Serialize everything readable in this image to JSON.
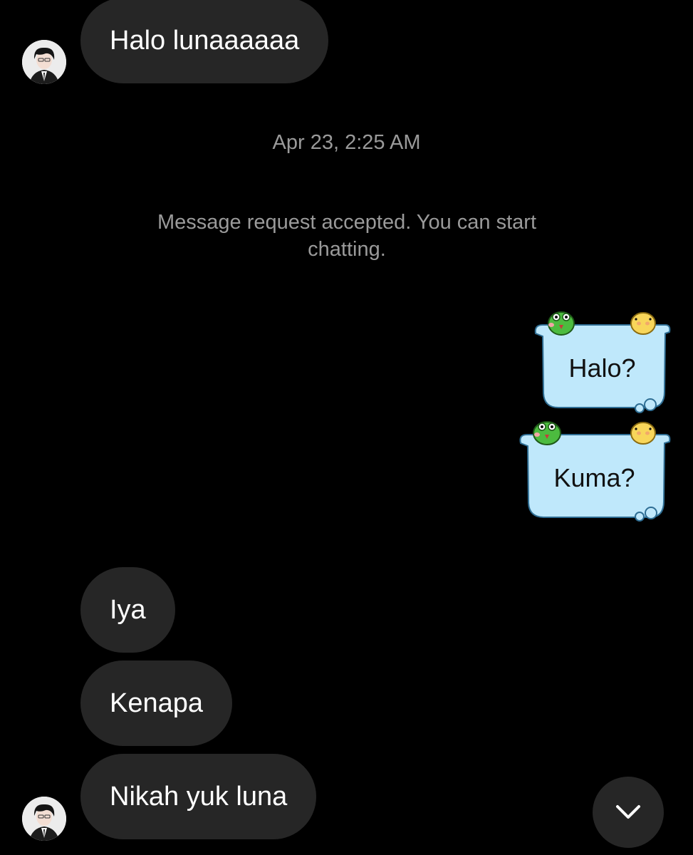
{
  "thread": {
    "timestamp": "Apr 23, 2:25 AM",
    "system_note": "Message request accepted. You can start chatting."
  },
  "messages": [
    {
      "direction": "incoming",
      "text": "Halo lunaaaaaa"
    },
    {
      "direction": "outgoing",
      "style": "sticker-bubble",
      "text": "Halo?"
    },
    {
      "direction": "outgoing",
      "style": "sticker-bubble",
      "text": "Kuma?"
    },
    {
      "direction": "incoming",
      "text": "Iya"
    },
    {
      "direction": "incoming",
      "text": "Kenapa"
    },
    {
      "direction": "incoming",
      "text": "Nikah yuk luna"
    }
  ],
  "icons": {
    "scroll_down": "chevron-down-icon",
    "sender_avatar": "avatar"
  },
  "colors": {
    "background": "#000000",
    "incoming_bubble": "#262626",
    "outgoing_sticker_bubble": "#bfe8fb",
    "meta_text": "#9a9a9a"
  }
}
